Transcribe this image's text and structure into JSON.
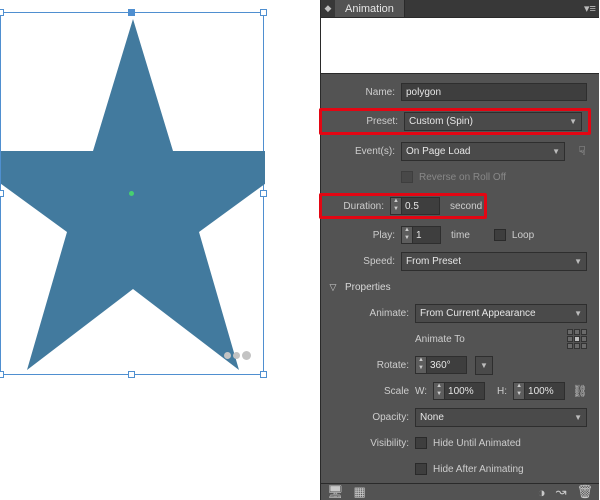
{
  "panel": {
    "title": "Animation"
  },
  "fields": {
    "name_label": "Name:",
    "name_value": "polygon",
    "preset_label": "Preset:",
    "preset_value": "Custom (Spin)",
    "events_label": "Event(s):",
    "events_value": "On Page Load",
    "reverse_label": "Reverse on Roll Off",
    "duration_label": "Duration:",
    "duration_value": "0.5",
    "duration_unit": "second",
    "play_label": "Play:",
    "play_value": "1",
    "play_unit": "time",
    "loop_label": "Loop",
    "speed_label": "Speed:",
    "speed_value": "From Preset"
  },
  "props": {
    "section": "Properties",
    "animate_label": "Animate:",
    "animate_value": "From Current Appearance",
    "animate_to": "Animate To",
    "rotate_label": "Rotate:",
    "rotate_value": "360°",
    "scale_label": "Scale",
    "w_label": "W:",
    "w_value": "100%",
    "h_label": "H:",
    "h_value": "100%",
    "opacity_label": "Opacity:",
    "opacity_value": "None",
    "visibility_label": "Visibility:",
    "hide_until": "Hide Until Animated",
    "hide_after": "Hide After Animating"
  },
  "shape": {
    "fill": "#427a9e"
  }
}
